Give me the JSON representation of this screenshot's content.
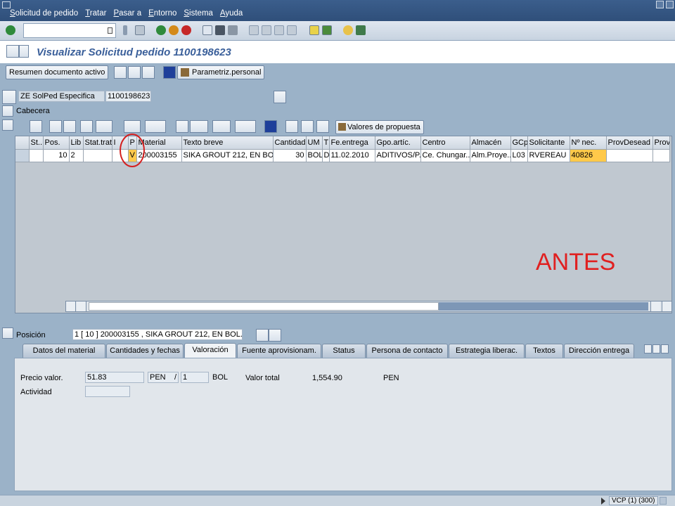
{
  "menu": [
    "Solicitud de pedido",
    "Tratar",
    "Pasar a",
    "Entorno",
    "Sistema",
    "Ayuda"
  ],
  "title": "Visualizar Solicitud pedido 1100198623",
  "app_toolbar": {
    "summary_button": "Resumen documento activo",
    "personal_button": "Parametriz.personal"
  },
  "header_doc": {
    "doc_type": "ZE SolPed Especifica",
    "doc_number": "1100198623"
  },
  "section_header": "Cabecera",
  "grid_toolbar": {
    "proposal_button": "Valores de propuesta"
  },
  "grid": {
    "columns": [
      "St...",
      "Pos.",
      "Lib",
      "Stat.trat.",
      "I",
      "P",
      "Material",
      "Texto breve",
      "Cantidad",
      "UM",
      "T",
      "Fe.entrega",
      "Gpo.artíc.",
      "Centro",
      "Almacén",
      "GCp",
      "Solicitante",
      "Nº nec.",
      "ProvDesead",
      "ProvF"
    ],
    "rows": [
      [
        "",
        "10",
        "2",
        "",
        "",
        "V",
        "200003155",
        "SIKA GROUT 212, EN BO...",
        "30",
        "BOL",
        "D",
        "11.02.2010",
        "ADITIVOS/P...",
        "Ce. Chungar...",
        "Alm.Proye...",
        "L03",
        "RVEREAU",
        "40826",
        "",
        ""
      ]
    ]
  },
  "annotation": "ANTES",
  "position": {
    "label": "Posición",
    "value": "1 [ 10 ] 200003155 , SIKA GROUT 212, EN BOL..."
  },
  "tabs": [
    "Datos del material",
    "Cantidades y fechas",
    "Valoración",
    "Fuente aprovisionam.",
    "Status",
    "Persona de contacto",
    "Estrategia liberac.",
    "Textos",
    "Dirección entrega"
  ],
  "active_tab": "Valoración",
  "valuation": {
    "price_label": "Precio valor.",
    "price_value": "51.83",
    "price_currency": "PEN",
    "slash": "/",
    "per_qty": "1",
    "per_unit": "BOL",
    "total_label": "Valor total",
    "total_value": "1,554.90",
    "total_currency": "PEN",
    "activity_label": "Actividad"
  },
  "status": {
    "system": "VCP (1) (300)"
  },
  "colors": {
    "highlight_cell": "#ffc94a",
    "annotation": "#e02020",
    "title": "#3a5f9a"
  }
}
